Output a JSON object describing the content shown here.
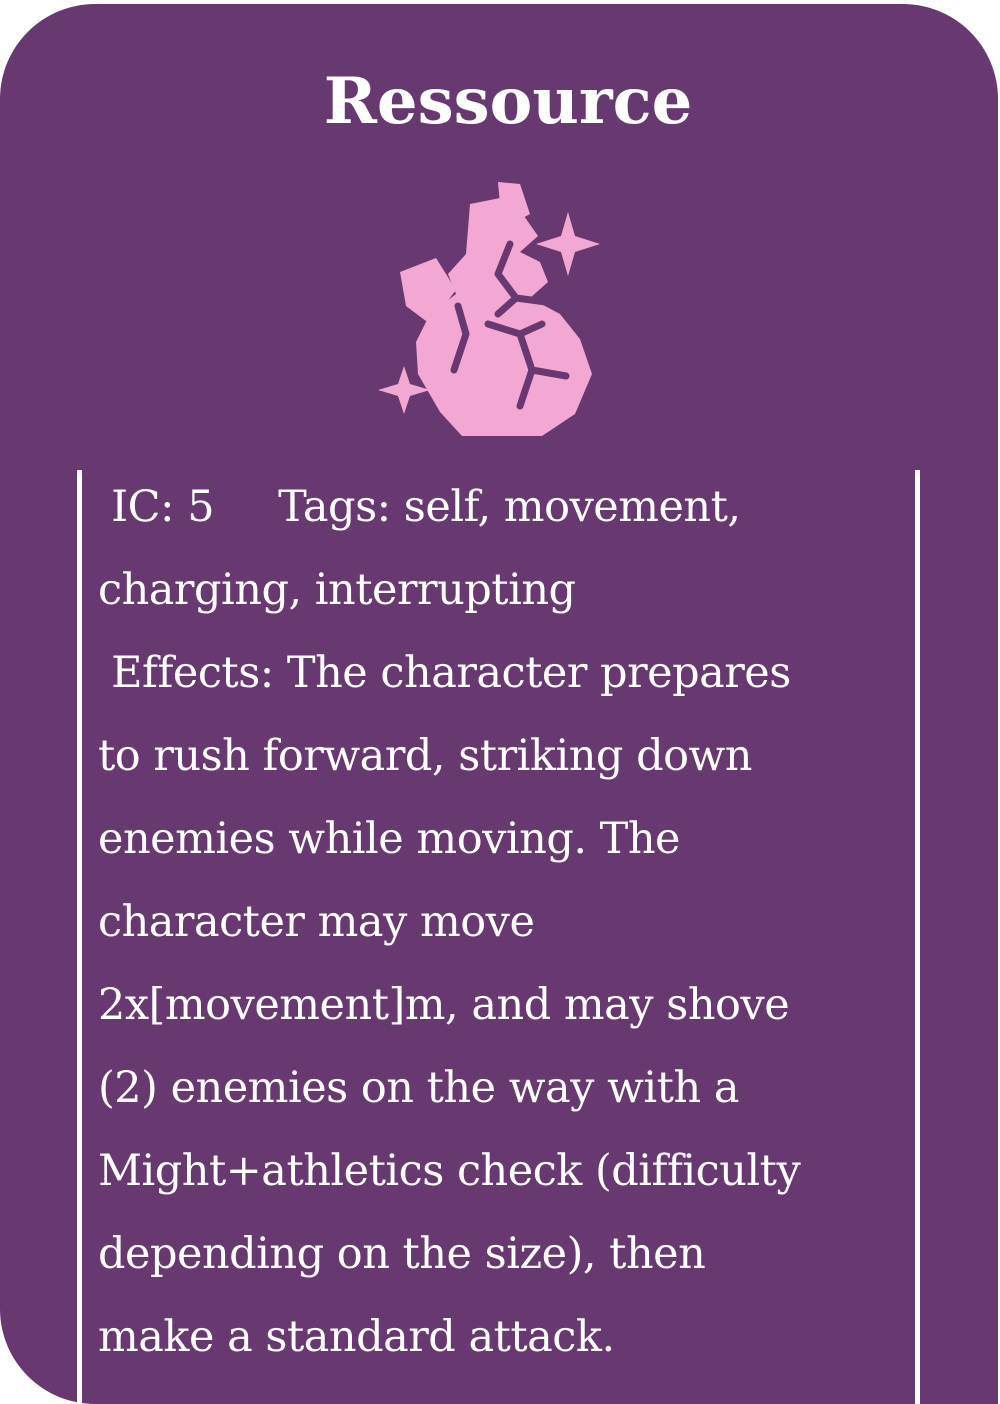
{
  "card": {
    "title": "Ressource",
    "icon": "cracked-fist-icon",
    "colors": {
      "background": "#683870",
      "icon": "#f2a8d2",
      "text": "#ffffff"
    },
    "ic": "IC: 5",
    "tags_line1": "Tags: self, movement,",
    "tags_line2": "charging, interrupting",
    "effects_lines": [
      "Effects: The character prepares",
      "to rush forward, striking down",
      "enemies while moving. The",
      "character may move",
      "2x[movement]m, and may shove",
      "(2) enemies on the way with a",
      "Might+athletics check (difficulty",
      "depending on the size), then",
      "make a standard attack."
    ]
  }
}
